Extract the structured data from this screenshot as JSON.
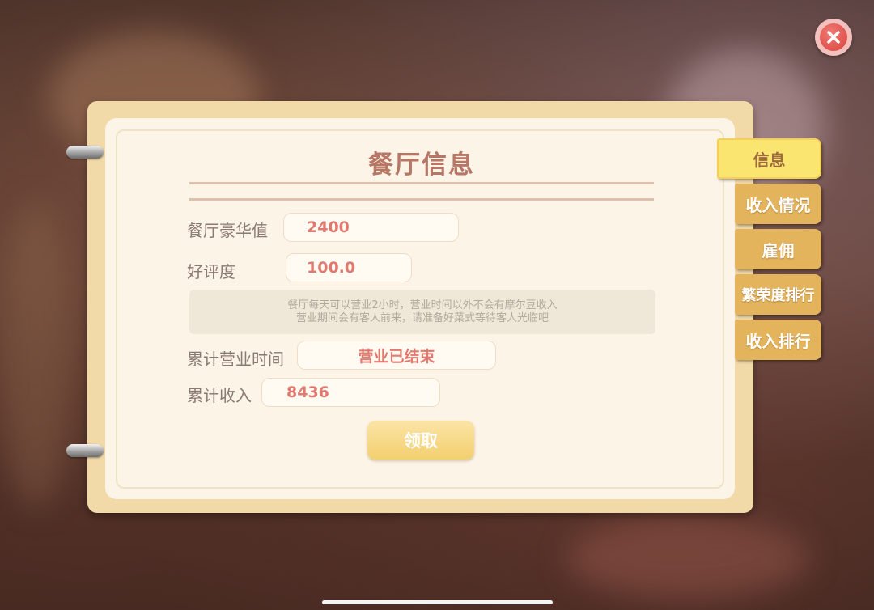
{
  "panel": {
    "title": "餐厅信息",
    "luxury_label": "餐厅豪华值",
    "luxury_value": "2400",
    "rating_label": "好评度",
    "rating_value": "100.0",
    "note_line1": "餐厅每天可以营业2小时，营业时间以外不会有摩尔豆收入",
    "note_line2": "营业期间会有客人前来，请准备好菜式等待客人光临吧",
    "business_time_label": "累计营业时间",
    "business_time_value": "营业已结束",
    "income_label": "累计收入",
    "income_value": "8436",
    "claim_label": "领取"
  },
  "tabs": [
    {
      "label": "信息",
      "active": true
    },
    {
      "label": "收入情况",
      "active": false
    },
    {
      "label": "雇佣",
      "active": false
    },
    {
      "label": "繁荣度排行",
      "active": false
    },
    {
      "label": "收入排行",
      "active": false
    }
  ],
  "icons": {
    "close": "close-icon"
  },
  "colors": {
    "title": "#b77666",
    "value_text": "#e07a70",
    "tab_inactive": "#e3b45c",
    "tab_active": "#fbe571",
    "claim_button": "#f3cf6f",
    "close_button": "#d9433d"
  }
}
